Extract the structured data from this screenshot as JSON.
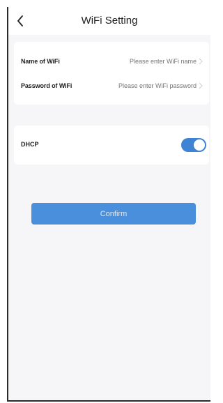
{
  "header": {
    "title": "WiFi Setting",
    "back_icon": "chevron-left-icon"
  },
  "wifi": {
    "name_label": "Name of WiFi",
    "name_placeholder": "Please enter WiFi name",
    "password_label": "Password of WiFi",
    "password_placeholder": "Please enter WiFi password",
    "chevron_icon": "chevron-right-icon"
  },
  "dhcp": {
    "label": "DHCP",
    "enabled": true
  },
  "confirm_label": "Confirm",
  "colors": {
    "accent": "#3e84d4",
    "button": "#4a8fdb",
    "background": "#f6f6f8",
    "placeholder": "#b6b6b6"
  }
}
